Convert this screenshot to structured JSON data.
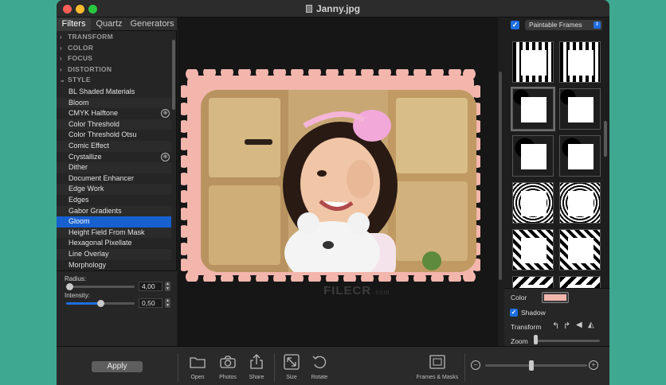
{
  "window": {
    "title": "Janny.jpg"
  },
  "sidebar": {
    "tabs": [
      "Filters",
      "Quartz",
      "Generators"
    ],
    "categories": [
      {
        "label": "TRANSFORM",
        "expanded": false
      },
      {
        "label": "COLOR",
        "expanded": false
      },
      {
        "label": "FOCUS",
        "expanded": false
      },
      {
        "label": "DISTORTION",
        "expanded": false
      },
      {
        "label": "STYLE",
        "expanded": true
      }
    ],
    "filters": [
      {
        "label": "BL Shaded Materials"
      },
      {
        "label": "Bloom"
      },
      {
        "label": "CMYK Halftone",
        "icon": "crosshair-icon"
      },
      {
        "label": "Color Threshold"
      },
      {
        "label": "Color Threshold Otsu"
      },
      {
        "label": "Comic Effect"
      },
      {
        "label": "Crystallize",
        "icon": "crosshair-icon"
      },
      {
        "label": "Dither"
      },
      {
        "label": "Document Enhancer"
      },
      {
        "label": "Edge Work"
      },
      {
        "label": "Edges"
      },
      {
        "label": "Gabor Gradients"
      },
      {
        "label": "Gloom",
        "selected": true
      },
      {
        "label": "Height Field From Mask"
      },
      {
        "label": "Hexagonal Pixellate"
      },
      {
        "label": "Line Overlay"
      },
      {
        "label": "Morphology"
      }
    ],
    "params": {
      "radius": {
        "label": "Radius:",
        "value": "4,00",
        "level": 0.05
      },
      "intensity": {
        "label": "Intensity:",
        "value": "0,50",
        "level": 0.5
      }
    }
  },
  "frames_panel": {
    "enabled": true,
    "dropdown": "Paintable Frames",
    "frame_count": 12,
    "selected_index": 2
  },
  "props": {
    "color_label": "Color",
    "frame_color": "#f2b6ad",
    "shadow_label": "Shadow",
    "shadow_checked": true,
    "transform_label": "Transform",
    "zoom_label": "Zoom",
    "zoom_level": 0.02
  },
  "toolbar": {
    "apply_label": "Apply",
    "buttons": [
      {
        "label": "Open",
        "icon": "folder-icon"
      },
      {
        "label": "Photos",
        "icon": "camera-icon"
      },
      {
        "label": "Share",
        "icon": "share-icon"
      },
      {
        "label": "Size",
        "icon": "resize-icon"
      },
      {
        "label": "Rotate",
        "icon": "rotate-icon"
      },
      {
        "label": "Frames & Masks",
        "icon": "frame-icon"
      }
    ],
    "zoom_level": 0.45
  },
  "watermark": {
    "text": "FILECR",
    "suffix": ".com"
  },
  "colors": {
    "accent": "#1e6ee0",
    "selection": "#1660cf",
    "frame": "#f2b6ad"
  }
}
